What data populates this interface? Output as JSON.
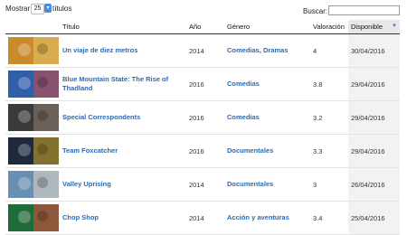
{
  "controls": {
    "show_label": "Mostrar",
    "page_length": "25",
    "titles_label": "títulos",
    "search_label": "Buscar:"
  },
  "columns": {
    "title": "Título",
    "year": "Año",
    "genre": "Género",
    "rating": "Valoración",
    "available": "Disponible"
  },
  "rows": [
    {
      "title": "Un viaje de diez metros",
      "year": "2014",
      "genre": "Comedias, Dramas",
      "rating": "4",
      "available": "30/04/2016",
      "thumb_colors": [
        "#c98b2b",
        "#e6c36a"
      ]
    },
    {
      "title": "Blue Mountain State: The Rise of Thadland",
      "year": "2016",
      "genre": "Comedias",
      "rating": "3.8",
      "available": "29/04/2016",
      "thumb_colors": [
        "#2f5fa8",
        "#c44a4a"
      ]
    },
    {
      "title": "Special Correspondents",
      "year": "2016",
      "genre": "Comedias",
      "rating": "3.2",
      "available": "29/04/2016",
      "thumb_colors": [
        "#3a3a3a",
        "#8a7a6a"
      ]
    },
    {
      "title": "Team Foxcatcher",
      "year": "2016",
      "genre": "Documentales",
      "rating": "3.3",
      "available": "29/04/2016",
      "thumb_colors": [
        "#1e2a3a",
        "#c9a227"
      ]
    },
    {
      "title": "Valley Uprising",
      "year": "2014",
      "genre": "Documentales",
      "rating": "3",
      "available": "26/04/2016",
      "thumb_colors": [
        "#6b8fb0",
        "#d8d2c4"
      ]
    },
    {
      "title": "Chop Shop",
      "year": "2014",
      "genre": "Acción y aventuras",
      "rating": "3.4",
      "available": "25/04/2016",
      "thumb_colors": [
        "#1f6b3a",
        "#d64a3a"
      ]
    }
  ]
}
